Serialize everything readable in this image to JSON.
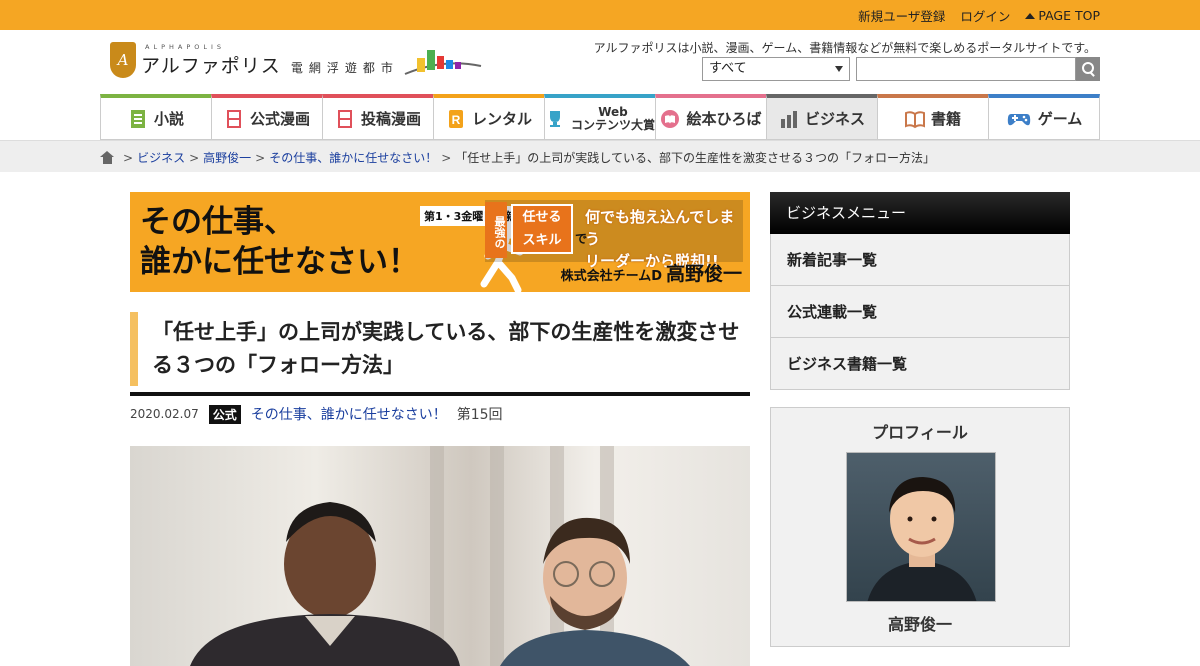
{
  "topbar": {
    "register": "新規ユーザ登録",
    "login": "ログイン",
    "pagetop": "PAGE TOP"
  },
  "header": {
    "logo_small": "ALPHAPOLIS",
    "logo_main": "アルファポリス",
    "logo_sub": "電網浮遊都市",
    "tagline": "アルファポリスは小説、漫画、ゲーム、書籍情報などが無料で楽しめるポータルサイトです。",
    "search_select": "すべて"
  },
  "nav": [
    {
      "label": "小説",
      "color": "#7cb342"
    },
    {
      "label": "公式漫画",
      "color": "#e0505a"
    },
    {
      "label": "投稿漫画",
      "color": "#e0505a"
    },
    {
      "label": "レンタル",
      "color": "#f3a21a"
    },
    {
      "label": "Web",
      "label2": "コンテンツ大賞",
      "color": "#37a3c8"
    },
    {
      "label": "絵本ひろば",
      "color": "#e4708d"
    },
    {
      "label": "ビジネス",
      "color": "#666666"
    },
    {
      "label": "書籍",
      "color": "#c9774a"
    },
    {
      "label": "ゲーム",
      "color": "#3d7fc8"
    }
  ],
  "breadcrumb": {
    "c1": "ビジネス",
    "c2": "高野俊一",
    "c3": "その仕事、誰かに任せなさい！",
    "current": "「任せ上手」の上司が実践している、部下の生産性を激変させる３つの「フォロー方法」"
  },
  "banner": {
    "title1": "その仕事、",
    "title2": "誰かに任せなさい！",
    "update": "第1・3金曜日更新",
    "strong": "最強の",
    "skill1": "任せる",
    "skill2": "スキル",
    "de": "で",
    "catch1": "何でも抱え込んでしまう",
    "catch2": "リーダーから脱却!!",
    "company": "株式会社チームD",
    "author": "高野俊一"
  },
  "article": {
    "title": "「任せ上手」の上司が実践している、部下の生産性を激変させる３つの「フォロー方法」",
    "date": "2020.02.07",
    "badge": "公式",
    "series": "その仕事、誰かに任せなさい！",
    "episode": "第15回"
  },
  "sidebar": {
    "menu_title": "ビジネスメニュー",
    "items": [
      "新着記事一覧",
      "公式連載一覧",
      "ビジネス書籍一覧"
    ],
    "profile_title": "プロフィール",
    "profile_name": "高野俊一"
  }
}
